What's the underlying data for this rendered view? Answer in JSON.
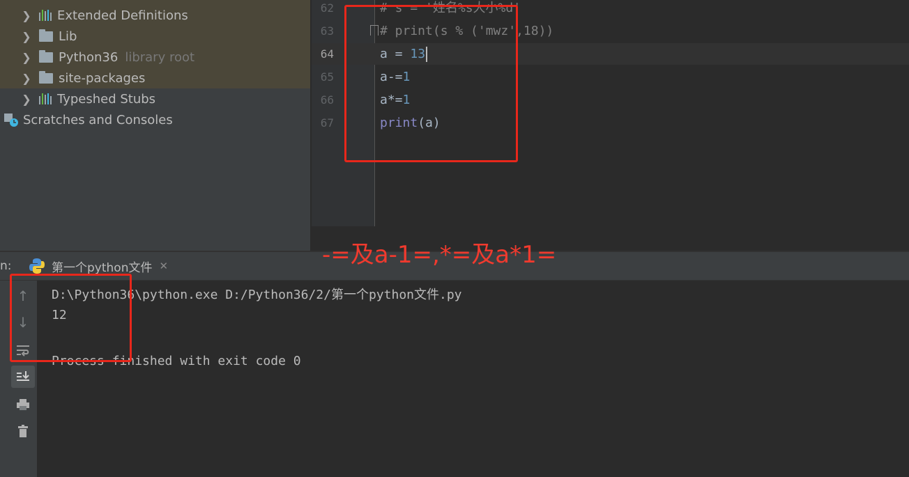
{
  "project_tree": {
    "items": [
      {
        "label": "Extended Definitions",
        "icon": "library-icon",
        "hint": ""
      },
      {
        "label": "Lib",
        "icon": "folder-icon",
        "hint": ""
      },
      {
        "label": "Python36",
        "icon": "folder-icon",
        "hint": "library root"
      },
      {
        "label": "site-packages",
        "icon": "folder-icon",
        "hint": ""
      },
      {
        "label": "Typeshed Stubs",
        "icon": "library-icon",
        "hint": ""
      }
    ],
    "scratches_label": "Scratches and Consoles"
  },
  "editor": {
    "lines": [
      {
        "num": "62",
        "text": "# s = '姓名%s大小%d'"
      },
      {
        "num": "63",
        "text": "# print(s % ('mwz',18))"
      },
      {
        "num": "64",
        "var": "a",
        "op": " = ",
        "value": "13"
      },
      {
        "num": "65",
        "var": "a",
        "op": "-=",
        "value": "1"
      },
      {
        "num": "66",
        "var": "a",
        "op": "*=",
        "value": "1"
      },
      {
        "num": "67",
        "func": "print",
        "arg": "(a)"
      }
    ],
    "active_line": "64"
  },
  "run_panel": {
    "label": "n:",
    "tab_label": "第一个python文件",
    "tab_close": "✕",
    "output": [
      "D:\\Python36\\python.exe D:/Python36/2/第一个python文件.py",
      "12",
      "",
      "Process finished with exit code 0"
    ],
    "tools": [
      "arrow-up-icon",
      "arrow-down-icon",
      "soft-wrap-icon",
      "scroll-to-end-icon",
      "print-icon",
      "trash-icon"
    ]
  },
  "annotation": {
    "text": "-=及a-1=,*=及a*1=",
    "color": "#e8271b"
  },
  "colors": {
    "tree_bg": "#3c3f41",
    "tree_highlight": "#4b4739",
    "editor_bg": "#2b2b2b",
    "comment": "#808080",
    "number": "#6897bb",
    "builtin": "#8888c6"
  }
}
